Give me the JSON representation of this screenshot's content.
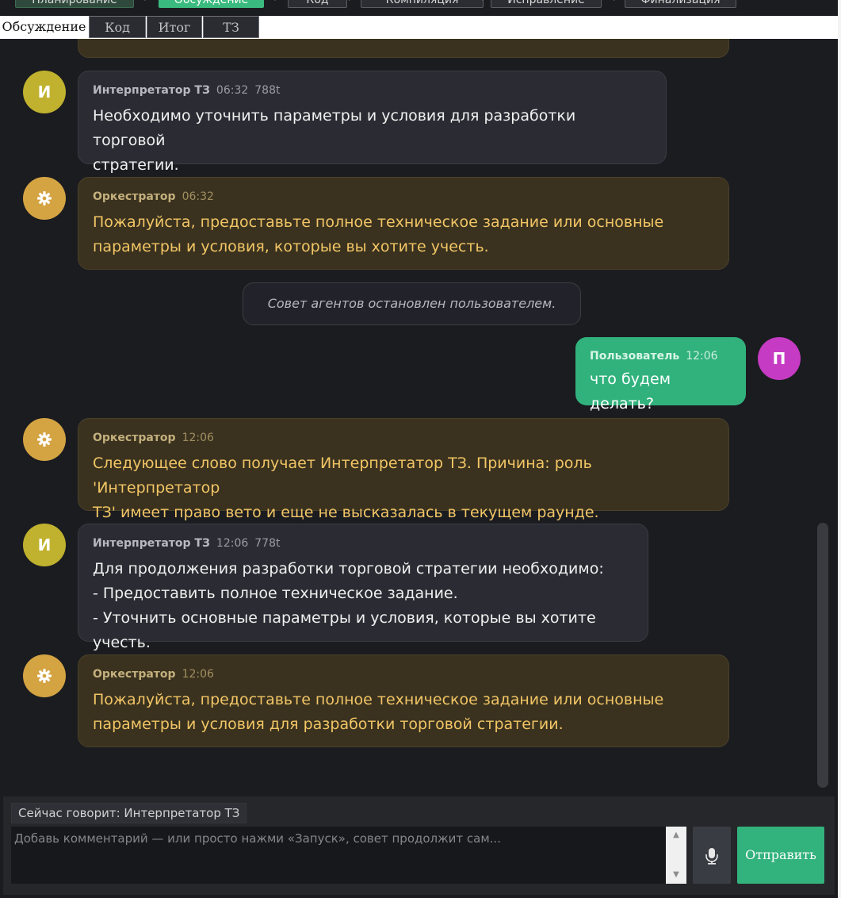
{
  "pipeline": {
    "stages": [
      "Планирование",
      "Обсуждение",
      "Код",
      "Компиляция",
      "Исправление",
      "Финализация"
    ],
    "active": "Обсуждение"
  },
  "tabs": [
    "Обсуждение",
    "Код",
    "Итог",
    "ТЗ"
  ],
  "messages": [
    {
      "role": "interpreter",
      "avatar_letter": "И",
      "name": "Интерпретатор ТЗ",
      "time": "06:32",
      "tokens": "788t",
      "text": "Необходимо уточнить параметры и условия для разработки торговой\nстратегии."
    },
    {
      "role": "orchestrator",
      "avatar_icon": "gear-icon",
      "name": "Оркестратор",
      "time": "06:32",
      "text": "Пожалуйста, предоставьте полное техническое задание или основные\nпараметры и условия, которые вы хотите учесть."
    },
    {
      "role": "system",
      "text": "Совет агентов остановлен пользователем."
    },
    {
      "role": "user",
      "avatar_letter": "П",
      "name": "Пользователь",
      "time": "12:06",
      "text": "что будем делать?"
    },
    {
      "role": "orchestrator",
      "avatar_icon": "gear-icon",
      "name": "Оркестратор",
      "time": "12:06",
      "text": "Следующее слово получает Интерпретатор ТЗ. Причина: роль 'Интерпретатор\nТЗ' имеет право вето и еще не высказалась в текущем раунде."
    },
    {
      "role": "interpreter",
      "avatar_letter": "И",
      "name": "Интерпретатор ТЗ",
      "time": "12:06",
      "tokens": "778t",
      "text": "Для продолжения разработки торговой стратегии необходимо:\n- Предоставить полное техническое задание.\n- Уточнить основные параметры и условия, которые вы хотите учесть."
    },
    {
      "role": "orchestrator",
      "avatar_icon": "gear-icon",
      "name": "Оркестратор",
      "time": "12:06",
      "text": "Пожалуйста, предоставьте полное техническое задание или основные\nпараметры и условия для разработки торговой стратегии."
    }
  ],
  "composer": {
    "speaking": "Сейчас говорит: Интерпретатор ТЗ",
    "placeholder": "Добавь комментарий — или просто нажми «Запуск», совет продолжит сам...",
    "mic_icon": "microphone-icon",
    "send_label": "Отправить"
  },
  "colors": {
    "accent": "#32b27c",
    "interpreter_avatar": "#c0b22e",
    "orchestrator_avatar": "#d4a443",
    "user_avatar": "#c63bc3",
    "orchestrator_text": "#f2c565"
  }
}
